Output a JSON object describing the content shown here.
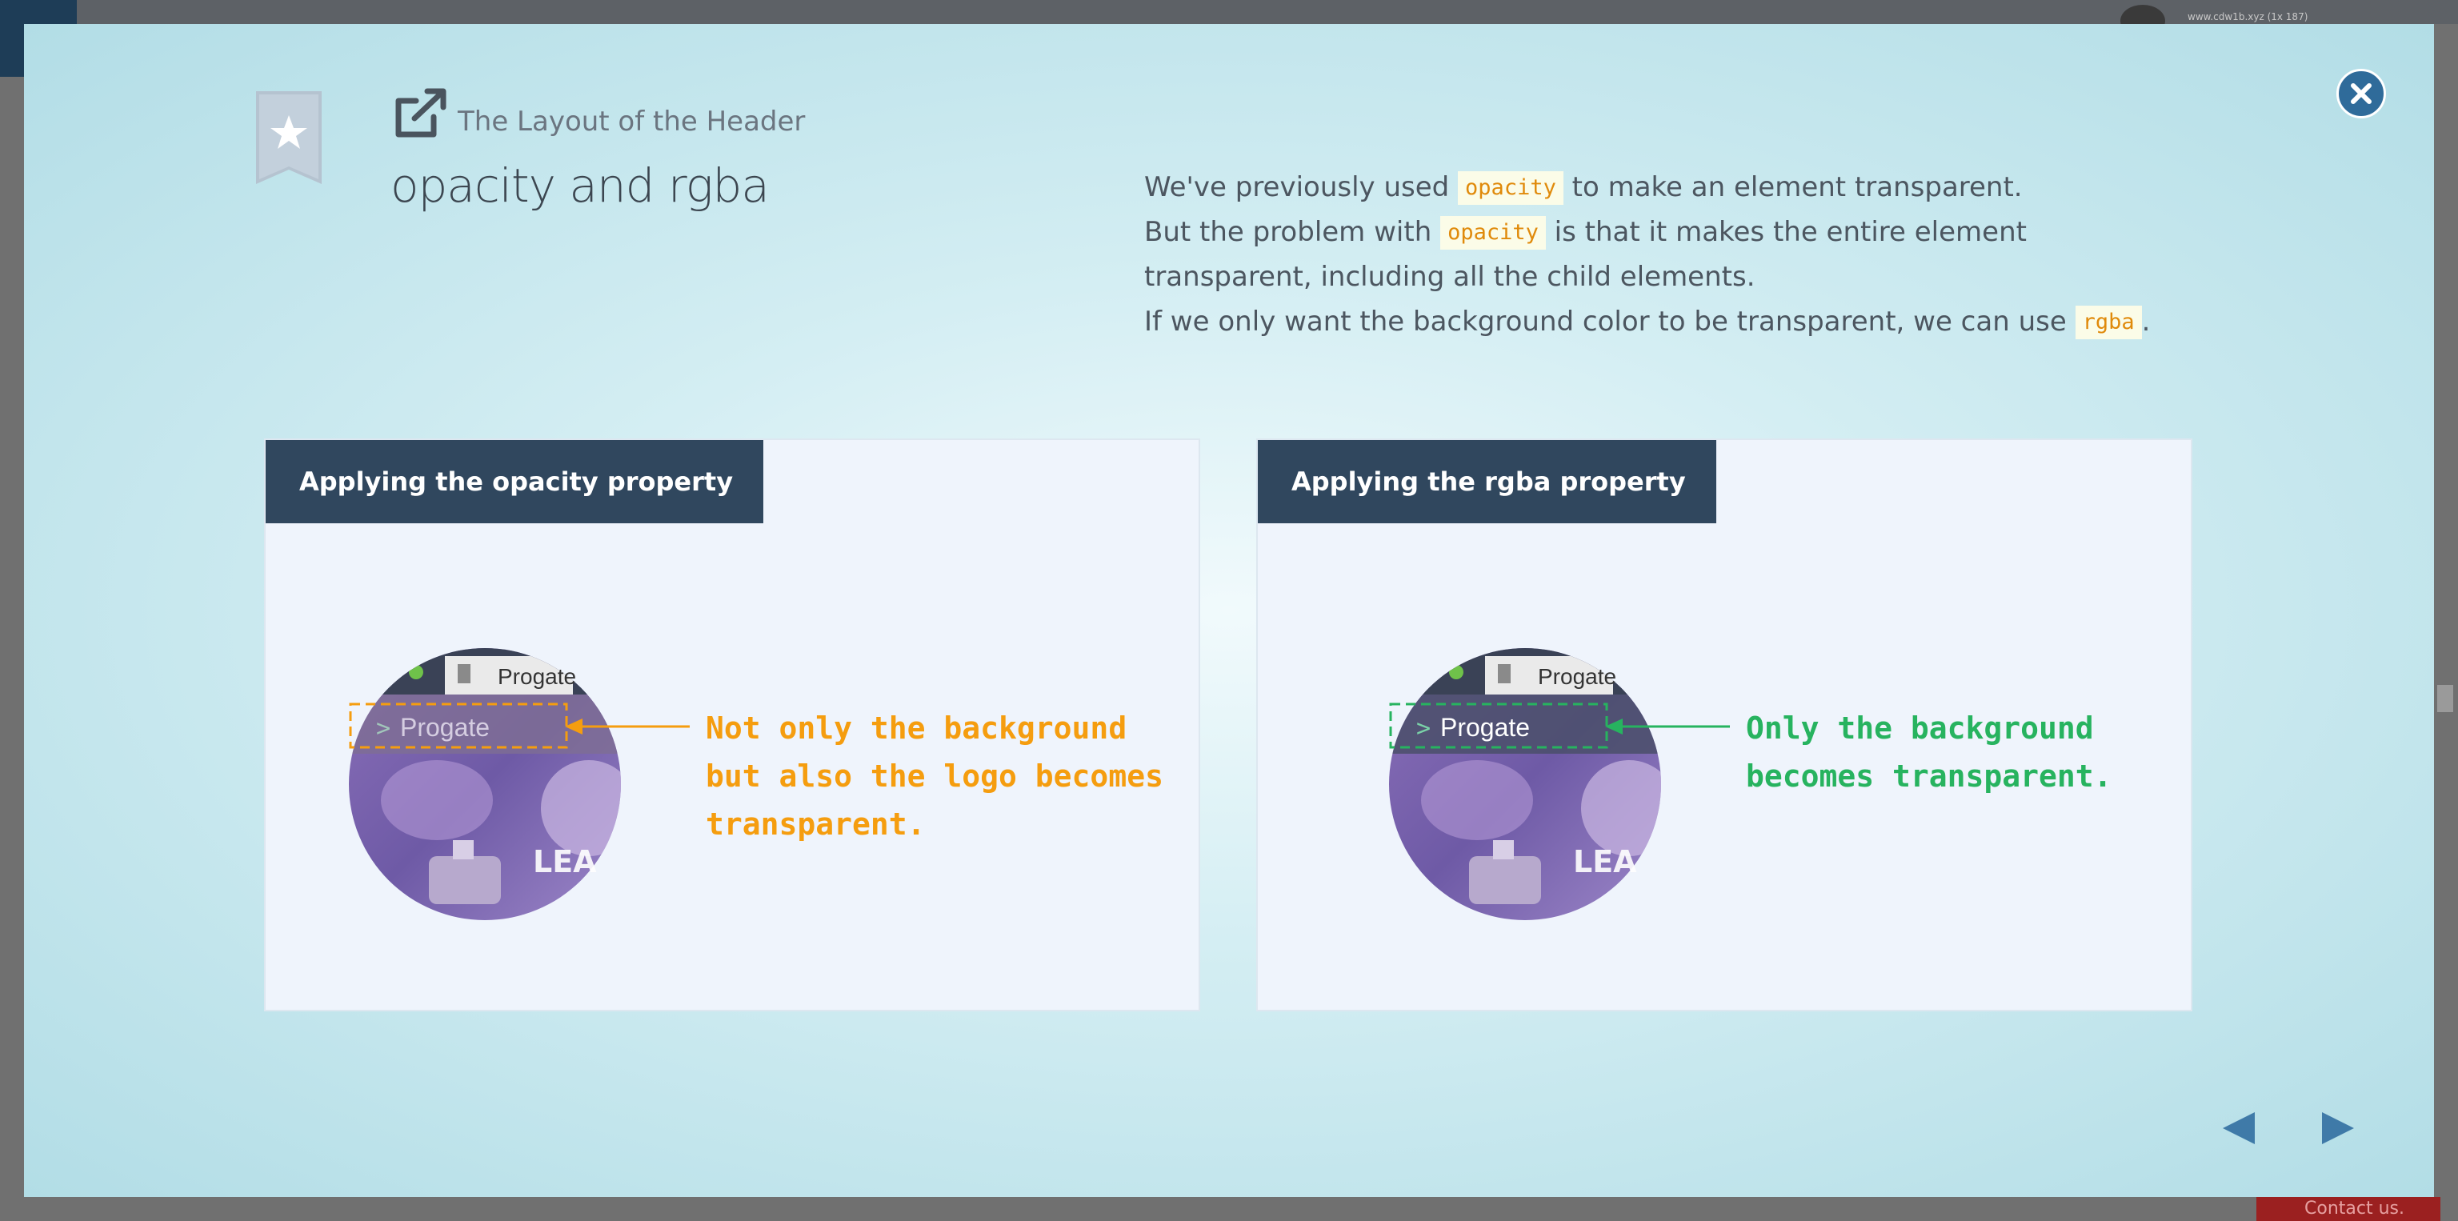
{
  "background": {
    "url_text": "www.cdw1b.xyz (1x 187)",
    "contact_label": "Contact us."
  },
  "header": {
    "lesson_title": "The Layout of the Header",
    "slide_title": "opacity and rgba"
  },
  "description": {
    "p1_before": "We've previously used ",
    "p1_code": "opacity",
    "p1_after": " to make an element transparent.",
    "p2_before": "But the problem with ",
    "p2_code": "opacity",
    "p2_after": " is that it makes the entire element transparent, including all the child elements.",
    "p3_before": "If we only want the background color to be transparent, we can use ",
    "p3_code": "rgba",
    "p3_after": "."
  },
  "panels": [
    {
      "header": "Applying the opacity property",
      "tab_label": "Progate",
      "logo_text": "Progate",
      "banner_text": "LEA",
      "annotation": "Not only the background\nbut also the logo becomes\ntransparent.",
      "accent_color": "#f59d0f"
    },
    {
      "header": "Applying the rgba property",
      "tab_label": "Progate",
      "logo_text": "Progate",
      "banner_text": "LEA",
      "annotation": "Only the background\nbecomes transparent.",
      "accent_color": "#27b35f"
    }
  ],
  "icons": {
    "bookmark": "bookmark-star-icon",
    "lesson": "external-link-icon",
    "close": "close-icon",
    "prev": "arrow-left-icon",
    "next": "arrow-right-icon"
  },
  "colors": {
    "navy": "#30475e",
    "close_blue": "#2f6b9a",
    "nav_arrow": "#3f7aa8",
    "code_orange": "#e08a0b"
  }
}
